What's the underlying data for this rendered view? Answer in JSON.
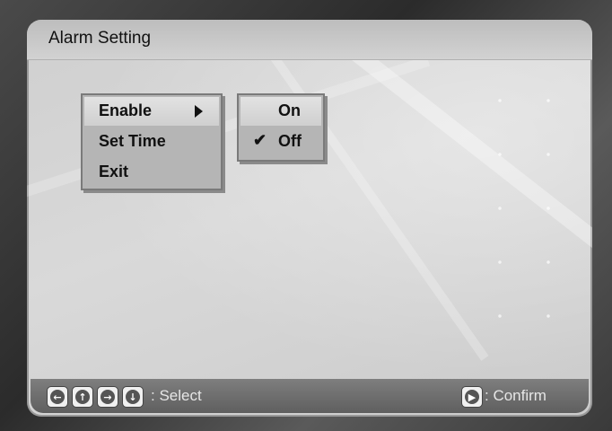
{
  "title": "Alarm Setting",
  "menu": {
    "items": [
      {
        "label": "Enable",
        "selected": true,
        "has_submenu": true
      },
      {
        "label": "Set Time",
        "selected": false
      },
      {
        "label": "Exit",
        "selected": false
      }
    ]
  },
  "submenu": {
    "items": [
      {
        "label": "On",
        "selected": true,
        "checked": false
      },
      {
        "label": "Off",
        "selected": false,
        "checked": true
      }
    ],
    "check_glyph": "✔"
  },
  "footer": {
    "nav_icons": [
      "left-arrow-icon",
      "up-arrow-icon",
      "right-arrow-icon",
      "down-arrow-icon"
    ],
    "select_label": ": Select",
    "confirm_icon": "play-icon",
    "confirm_label": ": Confirm"
  }
}
